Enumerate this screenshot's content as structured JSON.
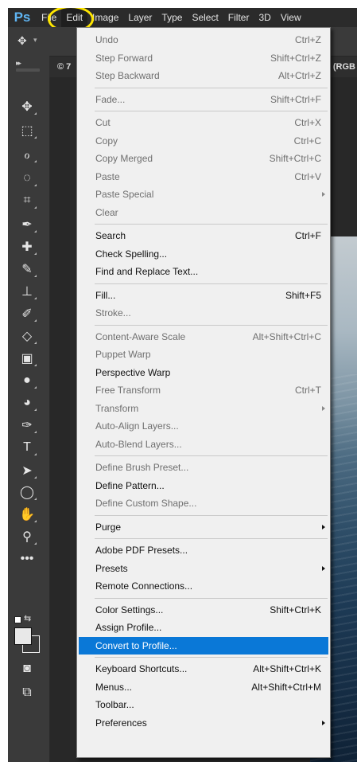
{
  "app": {
    "logo": "Ps"
  },
  "menubar": {
    "items": [
      "File",
      "Edit",
      "Image",
      "Layer",
      "Type",
      "Select",
      "Filter",
      "3D",
      "View"
    ]
  },
  "document": {
    "tab_title": "© 7",
    "color_mode": "(RGB"
  },
  "toolbar": {
    "tools": [
      {
        "name": "move-tool",
        "glyph": "✥"
      },
      {
        "name": "marquee-tool",
        "glyph": "⬚"
      },
      {
        "name": "lasso-tool",
        "glyph": "ℴ"
      },
      {
        "name": "quick-selection-tool",
        "glyph": "◌"
      },
      {
        "name": "crop-tool",
        "glyph": "⌗"
      },
      {
        "name": "eyedropper-tool",
        "glyph": "✒"
      },
      {
        "name": "healing-brush-tool",
        "glyph": "✚"
      },
      {
        "name": "brush-tool",
        "glyph": "✎"
      },
      {
        "name": "clone-stamp-tool",
        "glyph": "⊥"
      },
      {
        "name": "history-brush-tool",
        "glyph": "✐"
      },
      {
        "name": "eraser-tool",
        "glyph": "◇"
      },
      {
        "name": "gradient-tool",
        "glyph": "▣"
      },
      {
        "name": "blur-tool",
        "glyph": "●"
      },
      {
        "name": "dodge-tool",
        "glyph": "◕"
      },
      {
        "name": "pen-tool",
        "glyph": "✑"
      },
      {
        "name": "type-tool",
        "glyph": "T"
      },
      {
        "name": "path-selection-tool",
        "glyph": "➤"
      },
      {
        "name": "ellipse-tool",
        "glyph": "◯"
      },
      {
        "name": "hand-tool",
        "glyph": "✋"
      },
      {
        "name": "zoom-tool",
        "glyph": "⚲"
      },
      {
        "name": "more-tools",
        "glyph": "•••"
      },
      {
        "name": "quick-mask",
        "glyph": "◙"
      },
      {
        "name": "screen-mode",
        "glyph": "⧉"
      }
    ]
  },
  "edit_menu": {
    "items": [
      {
        "label": "Undo",
        "shortcut": "Ctrl+Z",
        "disabled": true
      },
      {
        "label": "Step Forward",
        "shortcut": "Shift+Ctrl+Z",
        "disabled": true
      },
      {
        "label": "Step Backward",
        "shortcut": "Alt+Ctrl+Z",
        "disabled": true
      },
      {
        "separator": true
      },
      {
        "label": "Fade...",
        "shortcut": "Shift+Ctrl+F",
        "disabled": true
      },
      {
        "separator": true
      },
      {
        "label": "Cut",
        "shortcut": "Ctrl+X",
        "disabled": true
      },
      {
        "label": "Copy",
        "shortcut": "Ctrl+C",
        "disabled": true
      },
      {
        "label": "Copy Merged",
        "shortcut": "Shift+Ctrl+C",
        "disabled": true
      },
      {
        "label": "Paste",
        "shortcut": "Ctrl+V",
        "disabled": true
      },
      {
        "label": "Paste Special",
        "submenu": true,
        "disabled": true
      },
      {
        "label": "Clear",
        "disabled": true
      },
      {
        "separator": true
      },
      {
        "label": "Search",
        "shortcut": "Ctrl+F"
      },
      {
        "label": "Check Spelling..."
      },
      {
        "label": "Find and Replace Text..."
      },
      {
        "separator": true
      },
      {
        "label": "Fill...",
        "shortcut": "Shift+F5"
      },
      {
        "label": "Stroke...",
        "disabled": true
      },
      {
        "separator": true
      },
      {
        "label": "Content-Aware Scale",
        "shortcut": "Alt+Shift+Ctrl+C",
        "disabled": true
      },
      {
        "label": "Puppet Warp",
        "disabled": true
      },
      {
        "label": "Perspective Warp"
      },
      {
        "label": "Free Transform",
        "shortcut": "Ctrl+T",
        "disabled": true
      },
      {
        "label": "Transform",
        "submenu": true,
        "disabled": true
      },
      {
        "label": "Auto-Align Layers...",
        "disabled": true
      },
      {
        "label": "Auto-Blend Layers...",
        "disabled": true
      },
      {
        "separator": true
      },
      {
        "label": "Define Brush Preset...",
        "disabled": true
      },
      {
        "label": "Define Pattern..."
      },
      {
        "label": "Define Custom Shape...",
        "disabled": true
      },
      {
        "separator": true
      },
      {
        "label": "Purge",
        "submenu": true
      },
      {
        "separator": true
      },
      {
        "label": "Adobe PDF Presets..."
      },
      {
        "label": "Presets",
        "submenu": true
      },
      {
        "label": "Remote Connections..."
      },
      {
        "separator": true
      },
      {
        "label": "Color Settings...",
        "shortcut": "Shift+Ctrl+K"
      },
      {
        "label": "Assign Profile..."
      },
      {
        "label": "Convert to Profile...",
        "selected": true
      },
      {
        "separator": true
      },
      {
        "label": "Keyboard Shortcuts...",
        "shortcut": "Alt+Shift+Ctrl+K"
      },
      {
        "label": "Menus...",
        "shortcut": "Alt+Shift+Ctrl+M"
      },
      {
        "label": "Toolbar..."
      },
      {
        "label": "Preferences",
        "submenu": true
      }
    ]
  }
}
